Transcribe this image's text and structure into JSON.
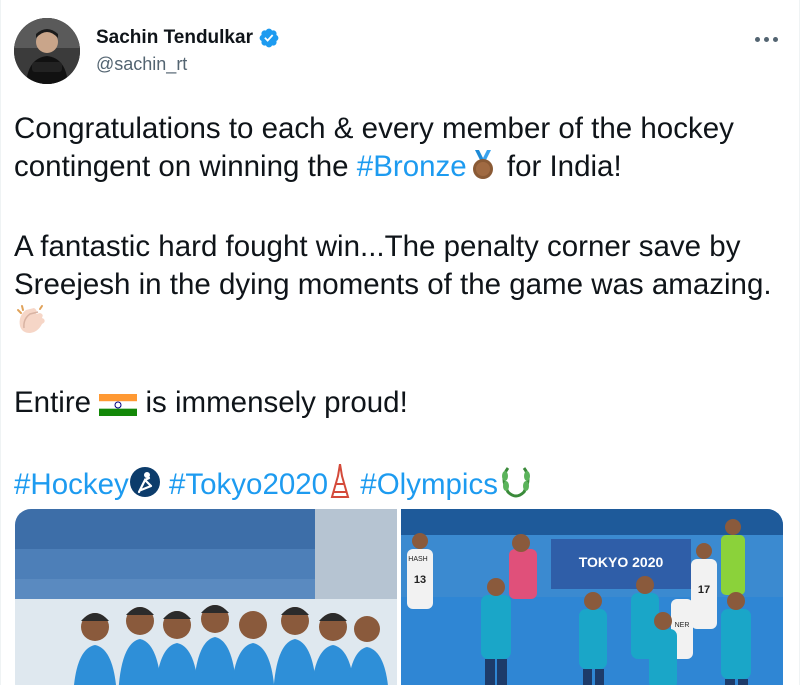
{
  "author": {
    "name": "Sachin Tendulkar",
    "handle": "@sachin_rt",
    "verified": true
  },
  "tweet": {
    "line1a": "Congratulations to each & every member of the hockey",
    "line2a": "contingent on winning the ",
    "hashtag_bronze": "#Bronze",
    "line2b": " for India!",
    "para2": "A fantastic hard fought win...The penalty corner save by Sreejesh in the dying moments of the game was amazing.",
    "para3a": "Entire ",
    "para3b": " is immensely proud!",
    "hashtags": [
      "#Hockey",
      "#Tokyo2020",
      "#Olympics"
    ]
  },
  "media": {
    "photo2_banner": "TOKYO 2020",
    "jersey_13": "13",
    "jersey_17": "17",
    "jersey_name_a": "HASH",
    "jersey_name_b": "NER"
  },
  "icons": {
    "verified": "verified-badge-icon",
    "more": "more-options-icon",
    "medal": "bronze-medal-emoji",
    "clap": "clapping-hands-emoji",
    "flag": "india-flag-emoji",
    "hockey": "hockey-emoji",
    "tower": "tokyo-tower-emoji",
    "wreath": "olympics-wreath-emoji"
  },
  "colors": {
    "link": "#1d9bf0",
    "text": "#0f1419",
    "secondary": "#536471",
    "verified": "#1d9bf0"
  }
}
